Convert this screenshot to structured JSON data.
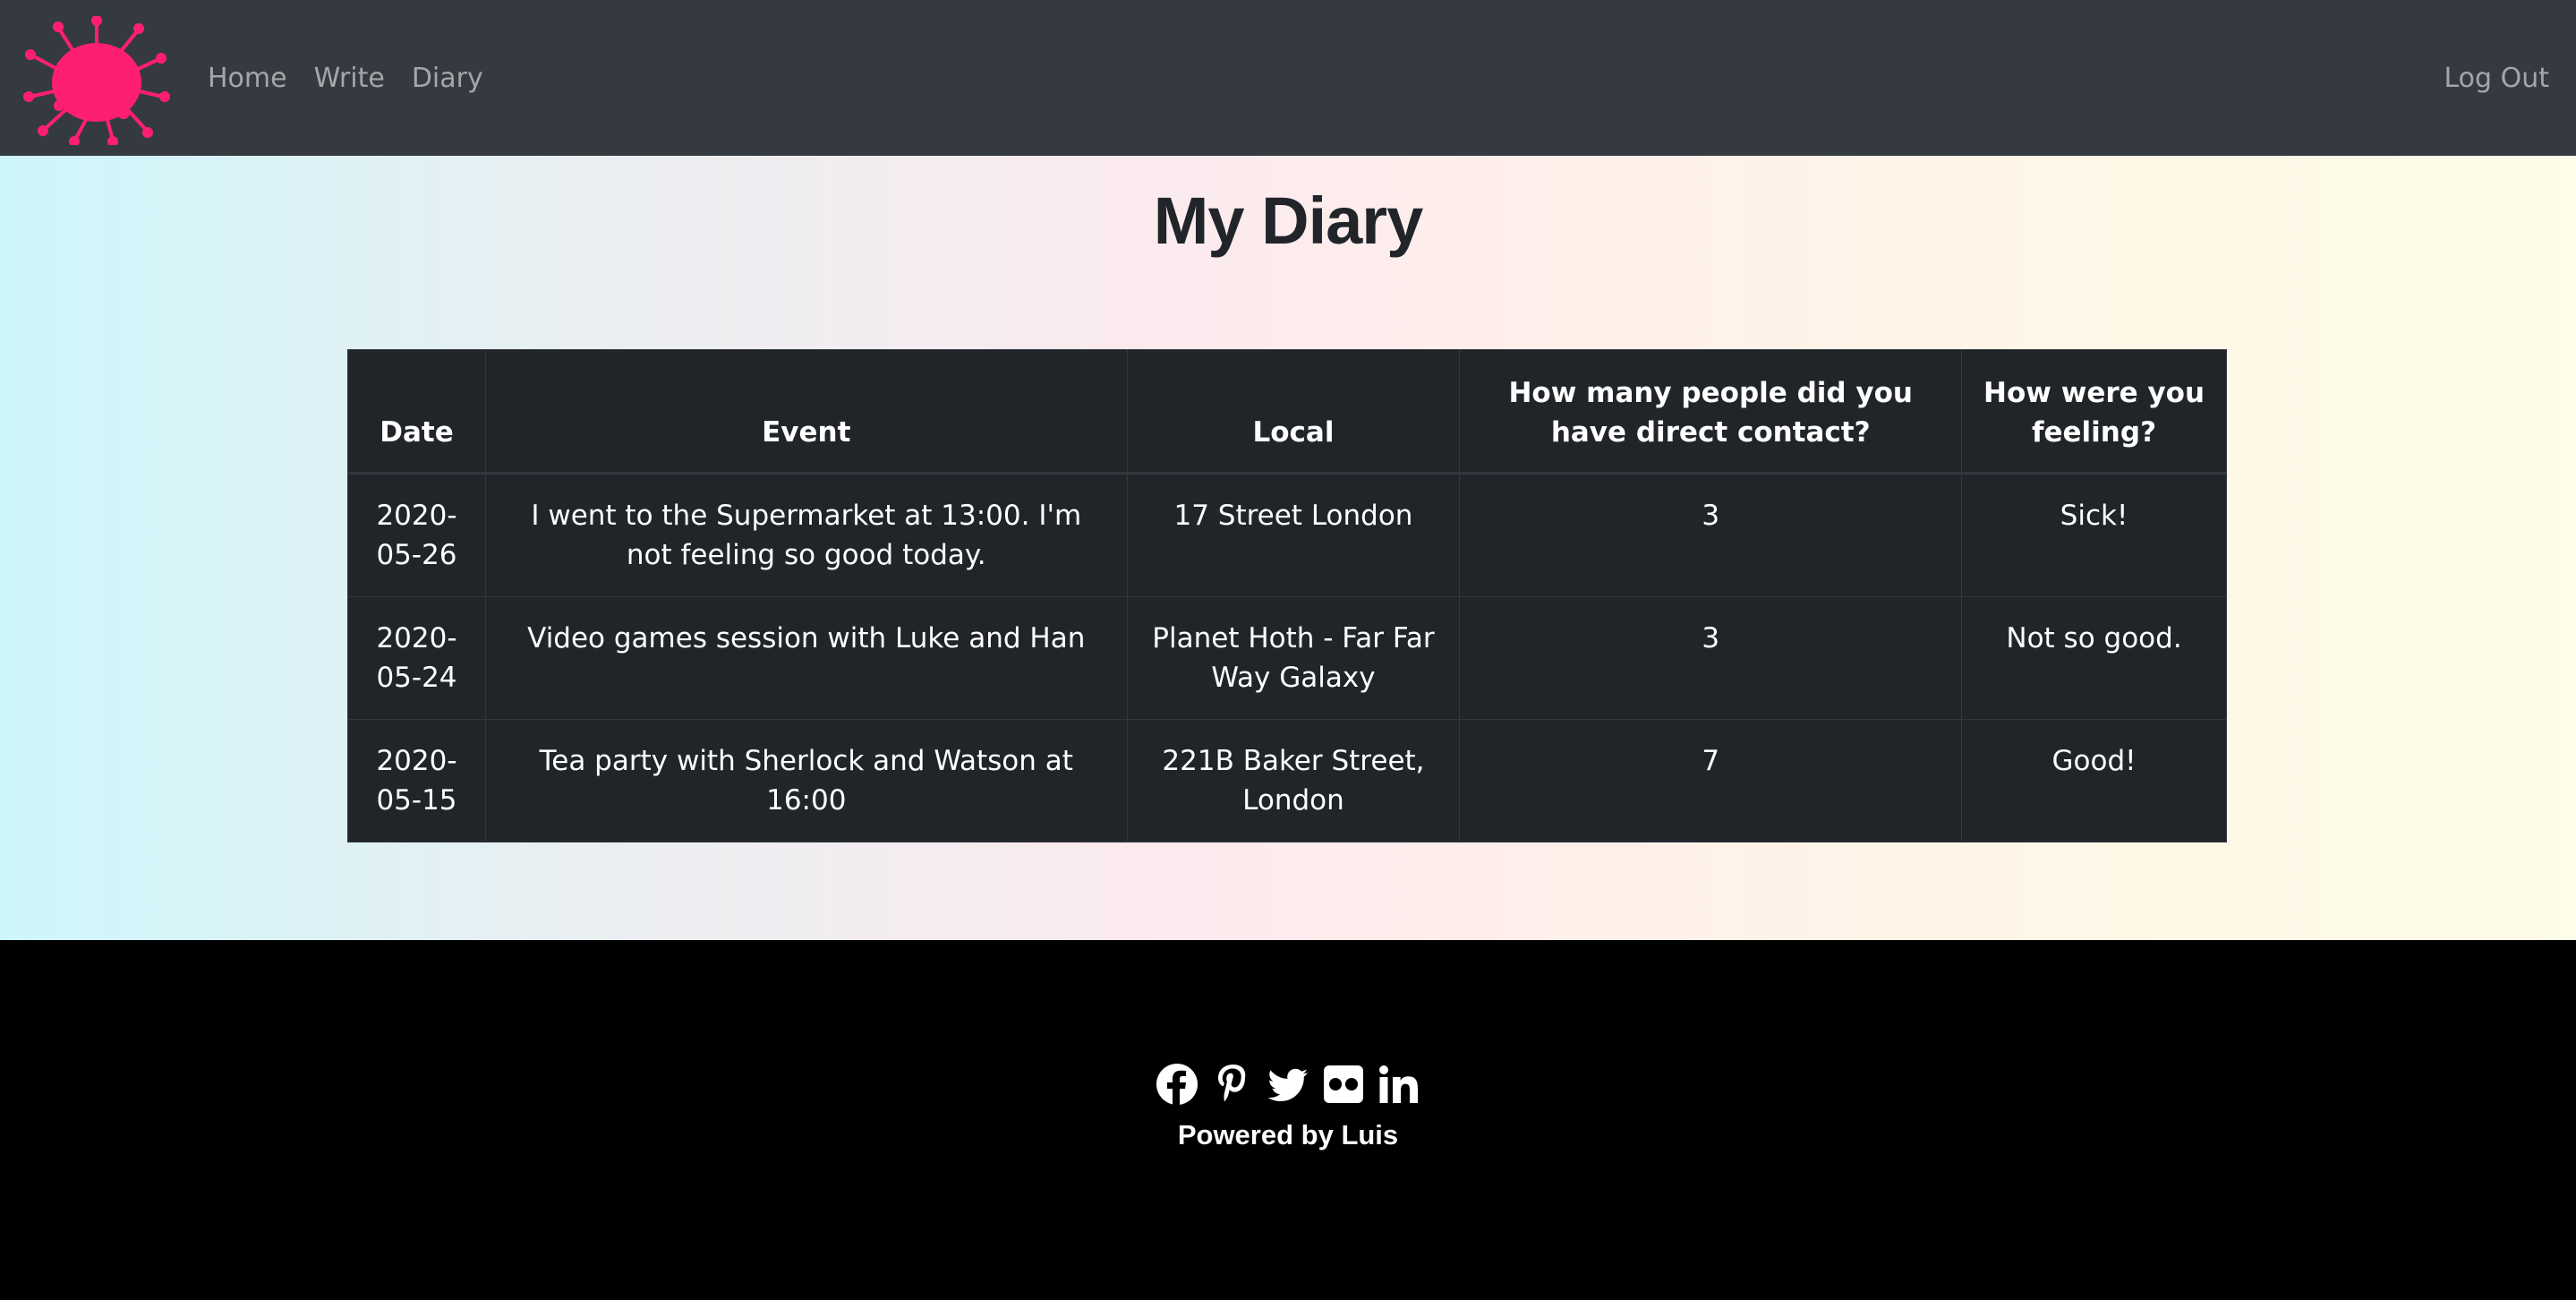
{
  "nav": {
    "logo_icon": "virus-splat-icon",
    "logo_color": "#ff1f72",
    "links": [
      "Home",
      "Write",
      "Diary"
    ],
    "logout": "Log Out"
  },
  "page": {
    "title": "My Diary"
  },
  "table": {
    "headers": [
      "Date",
      "Event",
      "Local",
      "How many people did you have direct contact?",
      "How were you feeling?"
    ],
    "rows": [
      [
        "2020-05-26",
        "I went to the Supermarket at 13:00. I'm not feeling so good today.",
        "17 Street London",
        "3",
        "Sick!"
      ],
      [
        "2020-05-24",
        "Video games session with Luke and Han",
        "Planet Hoth - Far Far Way Galaxy",
        "3",
        "Not so good."
      ],
      [
        "2020-05-15",
        "Tea party with Sherlock and Watson at 16:00",
        "221B Baker Street, London",
        "7",
        "Good!"
      ]
    ]
  },
  "footer": {
    "social_icons": [
      "facebook-icon",
      "pinterest-icon",
      "twitter-icon",
      "flickr-icon",
      "linkedin-icon"
    ],
    "powered_by": "Powered by Luis"
  }
}
